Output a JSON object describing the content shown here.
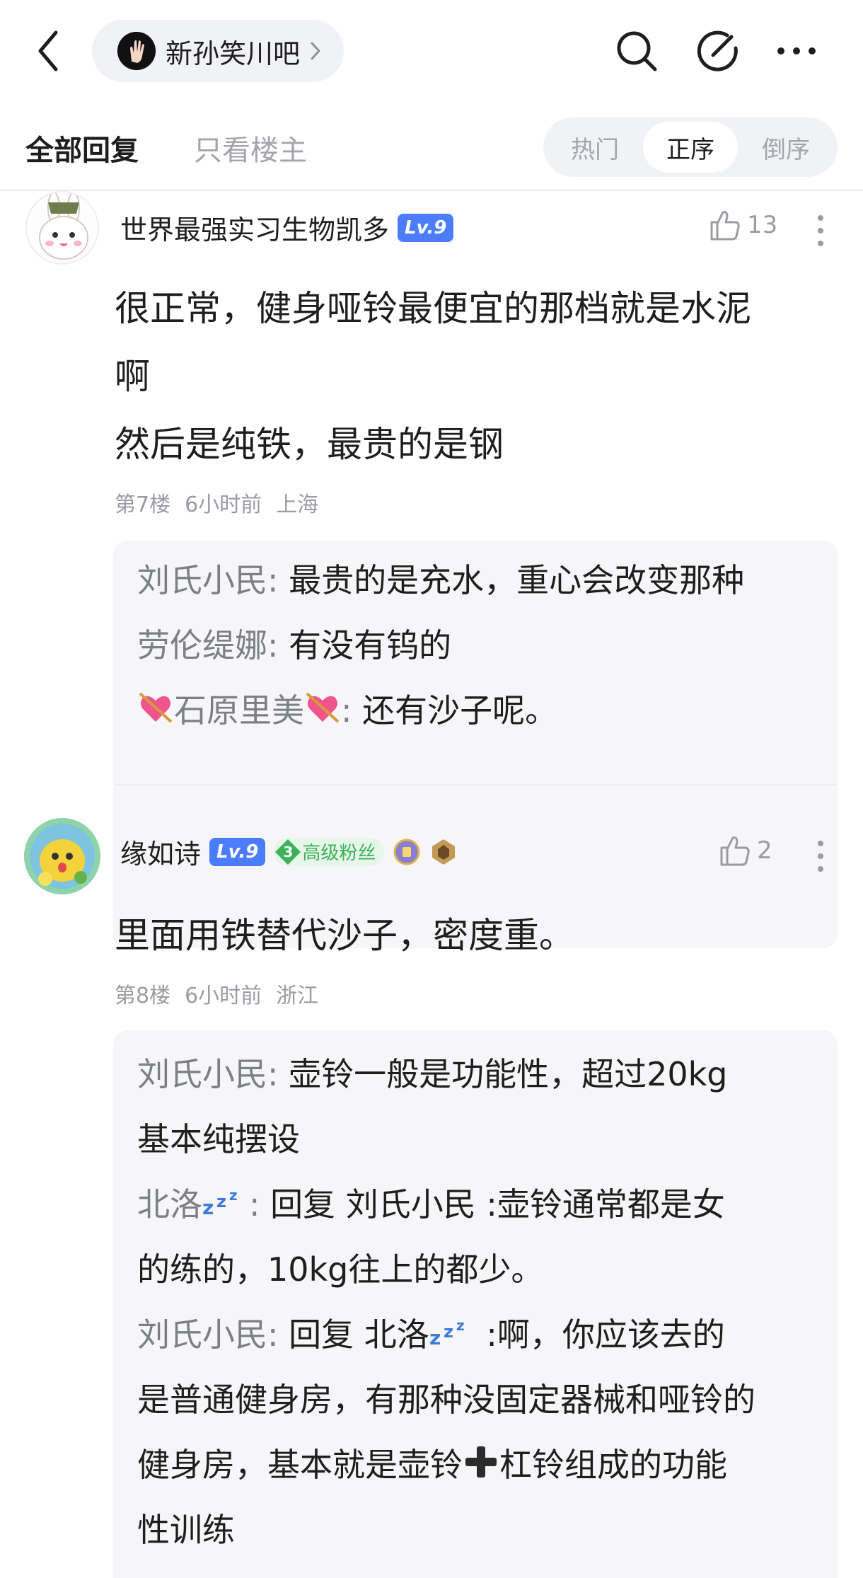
{
  "header": {
    "forum_name": "新孙笑川吧",
    "icons": [
      "back-arrow-icon",
      "search-icon",
      "edit-icon",
      "more-icon"
    ]
  },
  "tabs": {
    "all_replies": "全部回复",
    "op_only": "只看楼主",
    "sort_options": [
      "热门",
      "正序",
      "倒序"
    ],
    "active_sort": "正序"
  },
  "posts": [
    {
      "username": "世界最强实习生物凯多",
      "level": "Lv.9",
      "likes": "13",
      "body_lines": [
        "很正常，健身哑铃最便宜的那档就是水泥",
        "啊",
        "然后是纯铁，最贵的是钢"
      ],
      "floor": "第7楼",
      "time": "6小时前",
      "location": "上海",
      "replies": [
        {
          "name": "刘氏小民",
          "colon": ": ",
          "text": "最贵的是充水，重心会改变那种"
        },
        {
          "name": "劳伦缇娜",
          "colon": ": ",
          "text": "有没有钨的"
        },
        {
          "name": "石原里美",
          "colon": ": ",
          "text": "还有沙子呢。"
        }
      ]
    },
    {
      "username": "缘如诗",
      "level": "Lv.9",
      "fan_level": "3",
      "fan_label": "高级粉丝",
      "likes": "2",
      "body_lines": [
        "里面用铁替代沙子，密度重。"
      ],
      "floor": "第8楼",
      "time": "6小时前",
      "location": "浙江",
      "replies": [
        {
          "name": "刘氏小民",
          "colon": ": ",
          "text_lines": [
            "壶铃一般是功能性，超过20kg",
            "基本纯摆设"
          ]
        },
        {
          "name": "北洛",
          "colon": ": ",
          "reply_word": "回复 ",
          "reply_to": "刘氏小民",
          "text_lines": [
            " :壶铃通常都是女",
            "的练的，10kg往上的都少。"
          ]
        },
        {
          "name": "刘氏小民",
          "colon": ": ",
          "reply_word": "回复 ",
          "reply_to": "北洛",
          "text_lines": [
            " :啊，你应该去的",
            "是普通健身房，有那种没固定器械和哑铃的",
            "健身房，基本就是壶铃",
            "杠铃组成的功能",
            "性训练"
          ]
        }
      ]
    }
  ],
  "colors": {
    "level_badge": "#4c7dff",
    "fan_badge_text": "#3bb257",
    "reply_name": "#7c7f86",
    "reply_bg": "#f6f6f8"
  }
}
